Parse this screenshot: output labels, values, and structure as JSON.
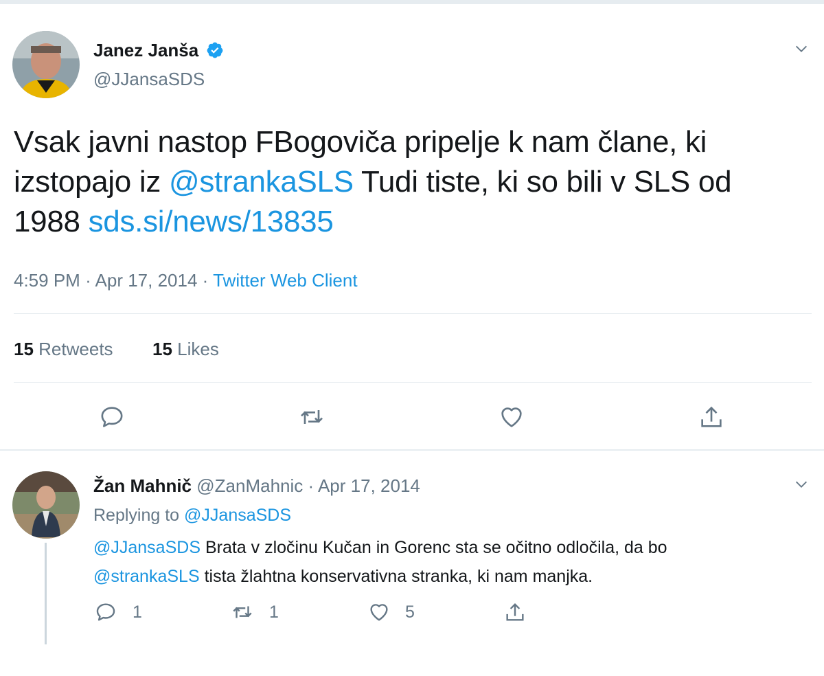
{
  "main_tweet": {
    "author_name": "Janez Janša",
    "author_handle": "@JJansaSDS",
    "text_before_mention": "Vsak javni nastop FBogoviča  pripelje k nam člane, ki izstopajo iz ",
    "mention": "@strankaSLS",
    "text_after_mention": " Tudi tiste, ki so bili v SLS od 1988 ",
    "link": "sds.si/news/13835",
    "time": "4:59 PM",
    "date": "Apr 17, 2014",
    "source": "Twitter Web Client",
    "retweets_count": "15",
    "retweets_label": "Retweets",
    "likes_count": "15",
    "likes_label": "Likes"
  },
  "reply": {
    "author_name": "Žan Mahnič",
    "author_handle": "@ZanMahnic",
    "date": "Apr 17, 2014",
    "replying_to_label": "Replying to ",
    "replying_to_handle": "@JJansaSDS",
    "text_mention1": "@JJansaSDS",
    "text_part1": " Brata v zločinu Kučan in Gorenc sta se očitno odločila, da bo",
    "text_mention2": "@strankaSLS",
    "text_part2": " tista žlahtna konservativna stranka, ki nam manjka.",
    "reply_count": "1",
    "retweet_count": "1",
    "like_count": "5"
  },
  "icons": {
    "verified": "verified-badge-icon",
    "chevron": "chevron-down-icon",
    "reply": "reply-icon",
    "retweet": "retweet-icon",
    "like": "heart-icon",
    "share": "share-icon"
  },
  "colors": {
    "link": "#1b95e0",
    "muted": "#657786",
    "text": "#14171a",
    "divider": "#e6ecf0"
  }
}
